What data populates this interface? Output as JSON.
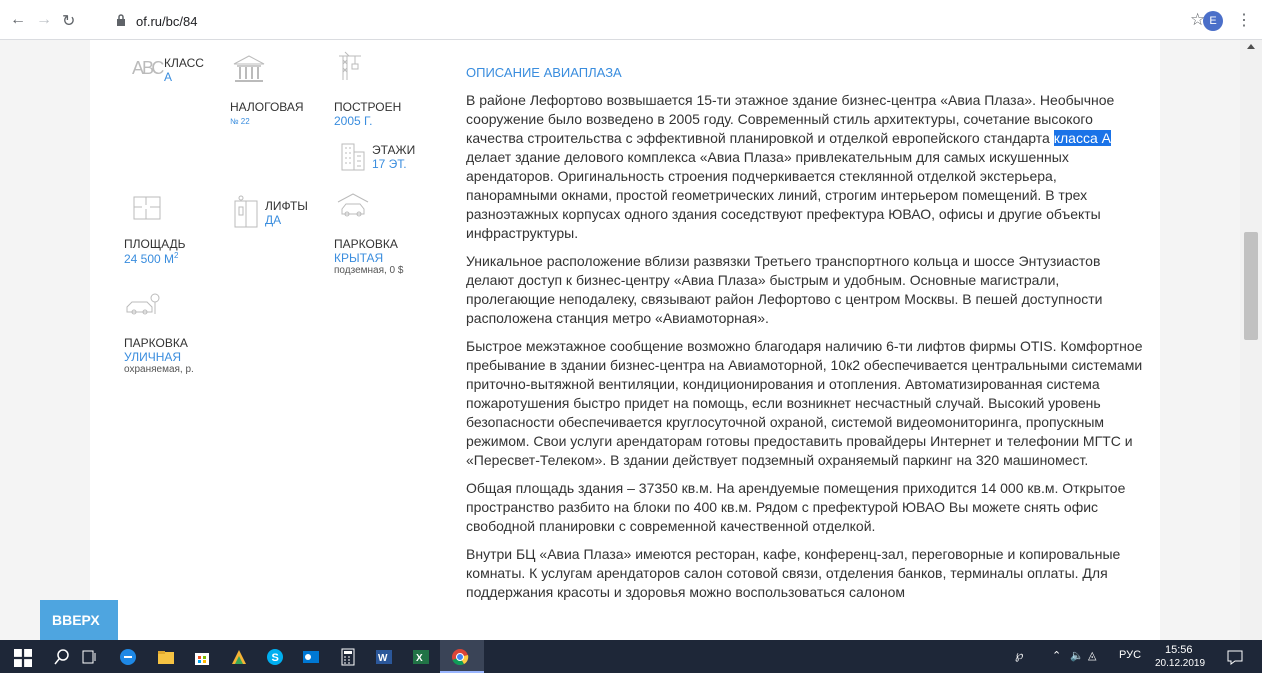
{
  "browser": {
    "url": "of.ru/bc/84",
    "avatar_letter": "E"
  },
  "features": {
    "class": {
      "label": "КЛАСС",
      "value": "A",
      "glyphs": "АВС"
    },
    "tax": {
      "label": "НАЛОГОВАЯ",
      "value": "№ 22"
    },
    "built": {
      "label": "ПОСТРОЕН",
      "value": "2005 Г."
    },
    "floors": {
      "label": "ЭТАЖИ",
      "value": "17 ЭТ."
    },
    "area": {
      "label": "ПЛОЩАДЬ",
      "value": "24 500 М",
      "sup": "2"
    },
    "lifts": {
      "label": "ЛИФТЫ",
      "value": "ДА"
    },
    "parking_covered": {
      "label": "ПАРКОВКА",
      "value": "КРЫТАЯ",
      "sub": "подземная, 0 $"
    },
    "parking_street": {
      "label": "ПАРКОВКА",
      "value": "УЛИЧНАЯ",
      "sub": "охраняемая, р."
    }
  },
  "description": {
    "title": "ОПИСАНИЕ АВИАПЛАЗА",
    "p1_before": "В районе Лефортово возвышается 15-ти этажное здание бизнес-центра «Авиа Плаза». Необычное сооружение было возведено в 2005 году. Современный стиль архитектуры, сочетание высокого качества строительства с эффективной планировкой и отделкой европейского стандарта ",
    "p1_highlight": "класса А",
    "p1_after": " делает здание делового комплекса «Авиа Плаза» привлекательным для самых искушенных арендаторов. Оригинальность строения подчеркивается стеклянной отделкой экстерьера, панорамными окнами, простой геометрических линий, строгим интерьером помещений. В трех разноэтажных корпусах одного здания соседствуют префектура ЮВАО, офисы и другие объекты инфраструктуры.",
    "p2": "Уникальное расположение вблизи развязки Третьего транспортного кольца и шоссе Энтузиастов делают доступ к бизнес-центру «Авиа Плаза» быстрым и удобным. Основные магистрали, пролегающие неподалеку, связывают район Лефортово с центром Москвы. В пешей доступности расположена станция метро «Авиамоторная».",
    "p3": "Быстрое межэтажное сообщение возможно благодаря наличию 6-ти лифтов фирмы OTIS. Комфортное пребывание в здании бизнес-центра на Авиамоторной, 10к2 обеспечивается центральными системами приточно-вытяжной вентиляции, кондиционирования и отопления. Автоматизированная система пожаротушения быстро придет на помощь, если возникнет несчастный случай. Высокий уровень безопасности обеспечивается круглосуточной охраной, системой видеомониторинга, пропускным режимом. Свои услуги арендаторам готовы предоставить провайдеры Интернет и телефонии МГТС и «Пересвет-Телеком». В здании действует подземный охраняемый паркинг на 320 машиномест.",
    "p4": "Общая площадь здания – 37350 кв.м. На арендуемые помещения приходится 14 000 кв.м. Открытое пространство разбито на блоки по 400 кв.м. Рядом с префектурой ЮВАО Вы можете снять офис свободной планировки с современной качественной отделкой.",
    "p5": "Внутри БЦ «Авиа Плаза» имеются ресторан, кафе, конференц-зал, переговорные и копировальные комнаты. К услугам арендаторов салон сотовой связи, отделения банков, терминалы оплаты. Для поддержания красоты и здоровья можно воспользоваться салоном"
  },
  "up_button": "ВВЕРХ",
  "taskbar": {
    "lang": "РУС",
    "time": "15:56",
    "date": "20.12.2019"
  }
}
